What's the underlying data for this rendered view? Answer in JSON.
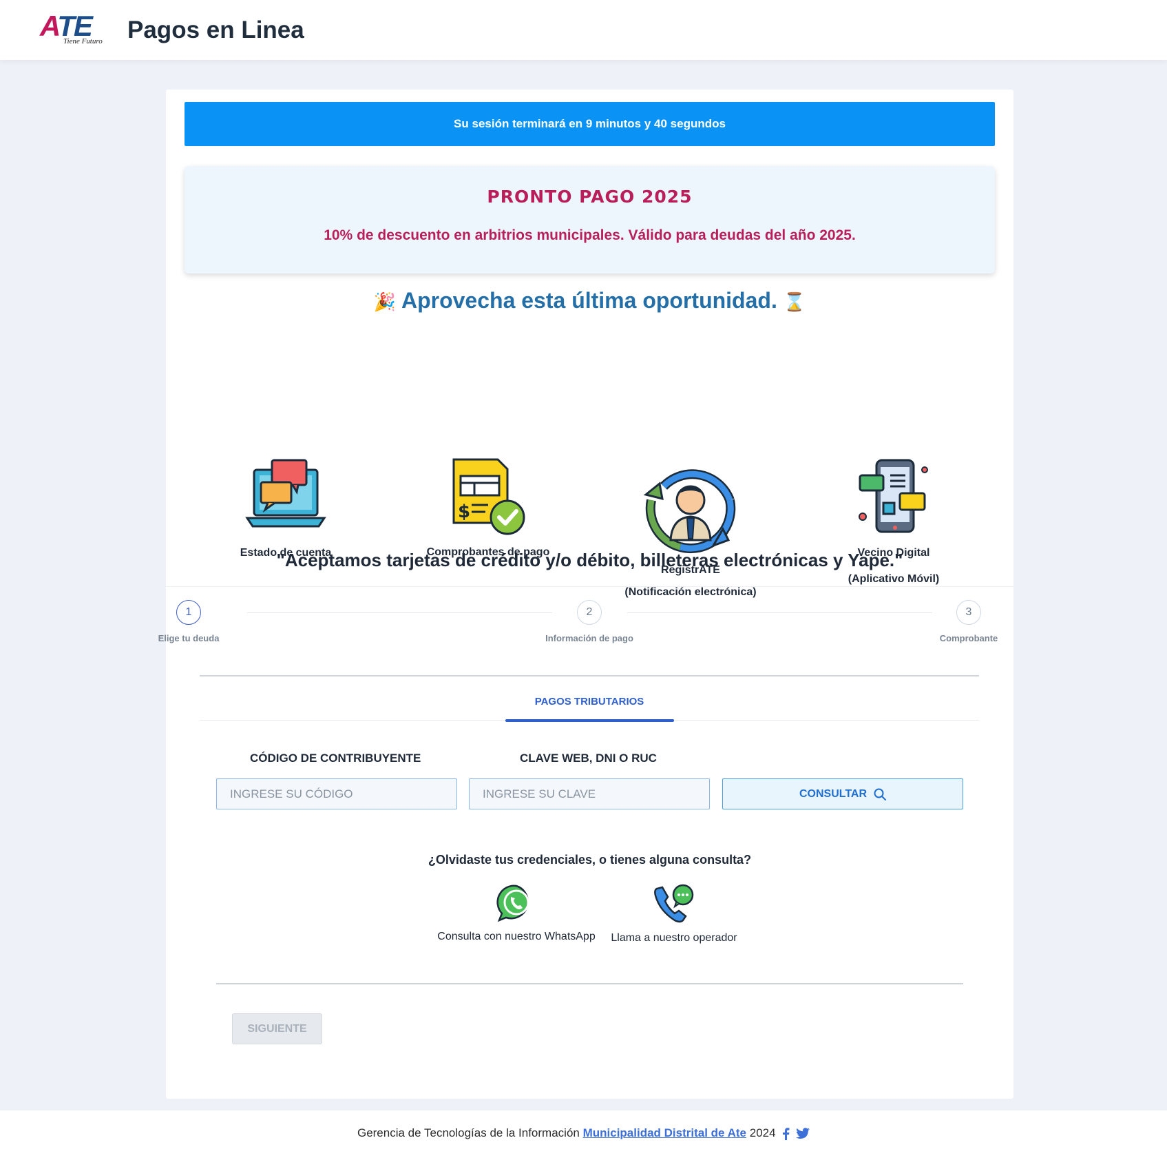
{
  "header": {
    "logo_main_a": "A",
    "logo_main_rest": "TE",
    "logo_sub": "Tiene Futuro",
    "title": "Pagos en Linea"
  },
  "session": {
    "text": "Su sesión terminará en 9 minutos y 40 segundos"
  },
  "promo": {
    "title": "PRONTO PAGO 2025",
    "text": "10% de descuento en arbitrios municipales. Válido para deudas del año 2025."
  },
  "cta": {
    "left_emoji": "🎉",
    "text": "Aprovecha esta última oportunidad.",
    "right_emoji": "⌛"
  },
  "services": [
    {
      "icon": "laptop-chat-icon",
      "label": "Estado de cuenta",
      "label2": ""
    },
    {
      "icon": "invoice-check-icon",
      "label": "Comprobantes de pago",
      "label2": ""
    },
    {
      "icon": "user-cycle-icon",
      "label": "RegistrATE",
      "label2": "(Notificación electrónica)"
    },
    {
      "icon": "mobile-app-icon",
      "label": "Vecino Digital",
      "label2": "(Aplicativo Móvil)"
    }
  ],
  "accept_text": "\"Aceptamos tarjetas de crédito y/o débito, billeteras electrónicas y Yape.\"",
  "stepper": [
    {
      "number": "1",
      "label": "Elige tu deuda",
      "active": true
    },
    {
      "number": "2",
      "label": "Información de pago",
      "active": false
    },
    {
      "number": "3",
      "label": "Comprobante",
      "active": false
    }
  ],
  "tab": {
    "label": "PAGOS TRIBUTARIOS"
  },
  "form": {
    "code_label": "CÓDIGO DE CONTRIBUYENTE",
    "code_placeholder": "INGRESE SU CÓDIGO",
    "code_value": "",
    "key_label": "CLAVE WEB, DNI O RUC",
    "key_placeholder": "INGRESE SU CLAVE",
    "key_value": "",
    "consult_label": "CONSULTAR"
  },
  "help": {
    "question": "¿Olvidaste tus credenciales, o tienes alguna consulta?",
    "whatsapp_label": "Consulta con nuestro WhatsApp",
    "phone_label": "Llama a nuestro operador"
  },
  "next_label": "SIGUIENTE",
  "footer": {
    "prefix": "Gerencia de Tecnologías de la Información",
    "link": "Municipalidad Distrital de Ate",
    "year": "2024"
  },
  "colors": {
    "accent": "#0a93f5",
    "promo": "#b81f5a",
    "tab": "#2f5fcf",
    "cta": "#246fa8"
  }
}
